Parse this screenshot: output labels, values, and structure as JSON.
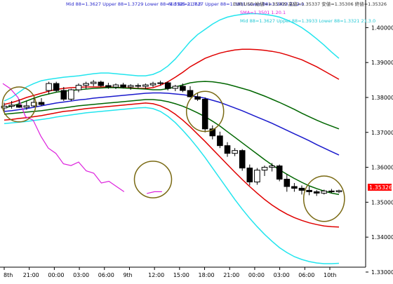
{
  "legend": {
    "line1_left": "Mid 88=1.3627 Upper 88=1.3729 Lower 88=1.3525  21.7.0",
    "line1_mid": "Mid 88=1.3627 Upper 88=1.3831 Lower 88=1.3423  21.2.0",
    "line1_right": "EUR/USD 始値=1.35309 高値=1.35337 安値=1.35306 終値=1.35326",
    "line2": "SMA=1.3501  1.20.1",
    "line3": "Mid 88=1.3627 Upper 88=1.3933 Lower 88=1.3321  21.3.0"
  },
  "current_price_label": "1.35326",
  "colors": {
    "background": "#ffffff",
    "mid_band": "#1a1acc",
    "band_1": "#006600",
    "band_2": "#e00000",
    "band_3": "#22e5ee",
    "sma": "#dd22dd",
    "circle": "#7a6a14",
    "candle": "#000000",
    "price_tag": "#ff0000"
  },
  "chart_data": {
    "type": "candlestick",
    "ylim": [
      1.332,
      1.4055
    ],
    "y_ticks": [
      "1.40000",
      "1.39000",
      "1.38000",
      "1.37000",
      "1.36000",
      "1.35000",
      "1.34000",
      "1.33000"
    ],
    "y_tick_values": [
      1.4,
      1.39,
      1.38,
      1.37,
      1.36,
      1.35,
      1.34,
      1.33
    ],
    "x_ticks": [
      "8th",
      "21:00",
      "00:00",
      "03:00",
      "06:00",
      "9th",
      "12:00",
      "15:00",
      "18:00",
      "21:00",
      "00:00",
      "03:00",
      "06:00",
      "10th"
    ],
    "candles": [
      {
        "o": 1.377,
        "h": 1.3785,
        "l": 1.3762,
        "c": 1.3775
      },
      {
        "o": 1.3775,
        "h": 1.379,
        "l": 1.3768,
        "c": 1.3778
      },
      {
        "o": 1.3778,
        "h": 1.3795,
        "l": 1.377,
        "c": 1.3772
      },
      {
        "o": 1.3772,
        "h": 1.379,
        "l": 1.3765,
        "c": 1.3776
      },
      {
        "o": 1.3776,
        "h": 1.38,
        "l": 1.3772,
        "c": 1.3786
      },
      {
        "o": 1.3786,
        "h": 1.3798,
        "l": 1.3776,
        "c": 1.378
      },
      {
        "o": 1.382,
        "h": 1.3845,
        "l": 1.381,
        "c": 1.384
      },
      {
        "o": 1.384,
        "h": 1.3845,
        "l": 1.3815,
        "c": 1.382
      },
      {
        "o": 1.382,
        "h": 1.383,
        "l": 1.379,
        "c": 1.3795
      },
      {
        "o": 1.3795,
        "h": 1.3825,
        "l": 1.379,
        "c": 1.3822
      },
      {
        "o": 1.3822,
        "h": 1.384,
        "l": 1.3815,
        "c": 1.3835
      },
      {
        "o": 1.3835,
        "h": 1.3845,
        "l": 1.3825,
        "c": 1.384
      },
      {
        "o": 1.384,
        "h": 1.385,
        "l": 1.3832,
        "c": 1.3844
      },
      {
        "o": 1.3844,
        "h": 1.3848,
        "l": 1.383,
        "c": 1.3834
      },
      {
        "o": 1.3834,
        "h": 1.3842,
        "l": 1.3825,
        "c": 1.383
      },
      {
        "o": 1.383,
        "h": 1.384,
        "l": 1.3824,
        "c": 1.3836
      },
      {
        "o": 1.3836,
        "h": 1.3842,
        "l": 1.3826,
        "c": 1.383
      },
      {
        "o": 1.383,
        "h": 1.3838,
        "l": 1.3822,
        "c": 1.3834
      },
      {
        "o": 1.3834,
        "h": 1.384,
        "l": 1.3826,
        "c": 1.3832
      },
      {
        "o": 1.3832,
        "h": 1.384,
        "l": 1.3825,
        "c": 1.3836
      },
      {
        "o": 1.3836,
        "h": 1.3845,
        "l": 1.383,
        "c": 1.384
      },
      {
        "o": 1.384,
        "h": 1.3848,
        "l": 1.3834,
        "c": 1.3842
      },
      {
        "o": 1.3842,
        "h": 1.3846,
        "l": 1.382,
        "c": 1.3826
      },
      {
        "o": 1.3826,
        "h": 1.3836,
        "l": 1.3818,
        "c": 1.3832
      },
      {
        "o": 1.3832,
        "h": 1.384,
        "l": 1.3815,
        "c": 1.382
      },
      {
        "o": 1.382,
        "h": 1.3832,
        "l": 1.38,
        "c": 1.3802
      },
      {
        "o": 1.3802,
        "h": 1.3812,
        "l": 1.379,
        "c": 1.3795
      },
      {
        "o": 1.3795,
        "h": 1.38,
        "l": 1.37,
        "c": 1.371
      },
      {
        "o": 1.371,
        "h": 1.372,
        "l": 1.368,
        "c": 1.369
      },
      {
        "o": 1.369,
        "h": 1.3702,
        "l": 1.3655,
        "c": 1.3662
      },
      {
        "o": 1.3662,
        "h": 1.3672,
        "l": 1.363,
        "c": 1.364
      },
      {
        "o": 1.364,
        "h": 1.3655,
        "l": 1.3632,
        "c": 1.3648
      },
      {
        "o": 1.3648,
        "h": 1.3652,
        "l": 1.359,
        "c": 1.3598
      },
      {
        "o": 1.3598,
        "h": 1.3608,
        "l": 1.3548,
        "c": 1.3558
      },
      {
        "o": 1.3558,
        "h": 1.3598,
        "l": 1.355,
        "c": 1.3592
      },
      {
        "o": 1.3592,
        "h": 1.3605,
        "l": 1.3575,
        "c": 1.36
      },
      {
        "o": 1.36,
        "h": 1.3612,
        "l": 1.3588,
        "c": 1.3604
      },
      {
        "o": 1.3604,
        "h": 1.3608,
        "l": 1.356,
        "c": 1.3566
      },
      {
        "o": 1.3566,
        "h": 1.358,
        "l": 1.353,
        "c": 1.3545
      },
      {
        "o": 1.3545,
        "h": 1.3555,
        "l": 1.353,
        "c": 1.354
      },
      {
        "o": 1.354,
        "h": 1.3548,
        "l": 1.3522,
        "c": 1.3534
      },
      {
        "o": 1.3534,
        "h": 1.3545,
        "l": 1.352,
        "c": 1.353
      },
      {
        "o": 1.353,
        "h": 1.3535,
        "l": 1.3518,
        "c": 1.3526
      },
      {
        "o": 1.3526,
        "h": 1.3536,
        "l": 1.3522,
        "c": 1.3532
      },
      {
        "o": 1.3532,
        "h": 1.3538,
        "l": 1.3526,
        "c": 1.353
      },
      {
        "o": 1.353,
        "h": 1.3536,
        "l": 1.3526,
        "c": 1.3533
      }
    ],
    "series": [
      {
        "key": "band_3_upper",
        "color_key": "band_3",
        "values": [
          1.379,
          1.38,
          1.3815,
          1.383,
          1.384,
          1.3848,
          1.3852,
          1.3855,
          1.3858,
          1.386,
          1.3862,
          1.3865,
          1.3868,
          1.387,
          1.387,
          1.3868,
          1.3866,
          1.3864,
          1.3862,
          1.3862,
          1.3866,
          1.3875,
          1.389,
          1.391,
          1.3935,
          1.396,
          1.398,
          1.3995,
          1.401,
          1.4022,
          1.403,
          1.4035,
          1.4038,
          1.404,
          1.404,
          1.4038,
          1.4035,
          1.403,
          1.4022,
          1.4012,
          1.4,
          1.3985,
          1.3968,
          1.395,
          1.393,
          1.3912
        ]
      },
      {
        "key": "band_2_upper",
        "color_key": "band_2",
        "values": [
          1.378,
          1.3785,
          1.3792,
          1.38,
          1.3806,
          1.3812,
          1.3818,
          1.3823,
          1.3826,
          1.3828,
          1.3829,
          1.383,
          1.383,
          1.383,
          1.383,
          1.3829,
          1.3828,
          1.3827,
          1.3826,
          1.3826,
          1.3828,
          1.3835,
          1.3845,
          1.3858,
          1.3872,
          1.3888,
          1.39,
          1.3912,
          1.392,
          1.3927,
          1.3932,
          1.3936,
          1.3938,
          1.3938,
          1.3937,
          1.3935,
          1.3932,
          1.3928,
          1.3922,
          1.3915,
          1.3908,
          1.3898,
          1.3888,
          1.3876,
          1.3864,
          1.3852
        ]
      },
      {
        "key": "band_1_upper",
        "color_key": "band_1",
        "values": [
          1.377,
          1.3775,
          1.3782,
          1.379,
          1.3798,
          1.3805,
          1.381,
          1.3815,
          1.3818,
          1.382,
          1.3822,
          1.3824,
          1.3826,
          1.3827,
          1.3828,
          1.3828,
          1.3827,
          1.3826,
          1.3825,
          1.3824,
          1.3822,
          1.3822,
          1.3825,
          1.383,
          1.3836,
          1.3842,
          1.3845,
          1.3846,
          1.3845,
          1.3842,
          1.3838,
          1.3832,
          1.3826,
          1.382,
          1.3812,
          1.3804,
          1.3795,
          1.3786,
          1.3776,
          1.3766,
          1.3755,
          1.3745,
          1.3735,
          1.3726,
          1.3718,
          1.371
        ]
      },
      {
        "key": "mid",
        "color_key": "mid_band",
        "values": [
          1.376,
          1.3762,
          1.3765,
          1.3768,
          1.3772,
          1.3776,
          1.378,
          1.3784,
          1.3787,
          1.379,
          1.3793,
          1.3795,
          1.3798,
          1.38,
          1.3802,
          1.3804,
          1.3806,
          1.3808,
          1.381,
          1.3812,
          1.3813,
          1.3813,
          1.3812,
          1.381,
          1.3808,
          1.3805,
          1.3802,
          1.3798,
          1.3792,
          1.3786,
          1.3778,
          1.377,
          1.3762,
          1.3753,
          1.3744,
          1.3735,
          1.3726,
          1.3716,
          1.3706,
          1.3696,
          1.3686,
          1.3676,
          1.3665,
          1.3655,
          1.3645,
          1.3635
        ]
      },
      {
        "key": "band_1_lower",
        "color_key": "band_1",
        "values": [
          1.3752,
          1.3754,
          1.3756,
          1.3758,
          1.376,
          1.3762,
          1.3765,
          1.3768,
          1.377,
          1.3773,
          1.3776,
          1.3778,
          1.378,
          1.3782,
          1.3784,
          1.3786,
          1.3788,
          1.379,
          1.3792,
          1.3794,
          1.3794,
          1.3792,
          1.3788,
          1.3782,
          1.3775,
          1.3766,
          1.3756,
          1.3745,
          1.3732,
          1.3718,
          1.3702,
          1.3686,
          1.367,
          1.3654,
          1.3638,
          1.3622,
          1.3607,
          1.3593,
          1.358,
          1.3568,
          1.3557,
          1.3547,
          1.3539,
          1.3532,
          1.3526,
          1.3522
        ]
      },
      {
        "key": "band_2_lower",
        "color_key": "band_2",
        "values": [
          1.3735,
          1.3737,
          1.374,
          1.3742,
          1.3745,
          1.3748,
          1.3752,
          1.3756,
          1.376,
          1.3762,
          1.3765,
          1.3768,
          1.377,
          1.3772,
          1.3774,
          1.3776,
          1.3778,
          1.378,
          1.3782,
          1.3784,
          1.3782,
          1.3776,
          1.3766,
          1.3752,
          1.3735,
          1.3716,
          1.3695,
          1.3674,
          1.3652,
          1.363,
          1.3608,
          1.3586,
          1.3565,
          1.3545,
          1.3526,
          1.3508,
          1.3492,
          1.3478,
          1.3466,
          1.3456,
          1.3448,
          1.3441,
          1.3436,
          1.3432,
          1.343,
          1.3429
        ]
      },
      {
        "key": "band_3_lower",
        "color_key": "band_3",
        "values": [
          1.3725,
          1.3727,
          1.3729,
          1.3731,
          1.3734,
          1.3737,
          1.374,
          1.3744,
          1.3747,
          1.375,
          1.3753,
          1.3756,
          1.3758,
          1.376,
          1.3762,
          1.3764,
          1.3766,
          1.3768,
          1.377,
          1.3771,
          1.3768,
          1.376,
          1.3746,
          1.3728,
          1.3706,
          1.3682,
          1.3656,
          1.3628,
          1.3598,
          1.3568,
          1.3538,
          1.3508,
          1.348,
          1.3454,
          1.343,
          1.3408,
          1.3388,
          1.337,
          1.3356,
          1.3344,
          1.3336,
          1.333,
          1.3326,
          1.3324,
          1.3324,
          1.3325
        ]
      },
      {
        "key": "sma",
        "color_key": "sma",
        "start_index": 0,
        "values": [
          1.384,
          1.3825,
          1.38,
          1.3745,
          1.3735,
          1.369,
          1.3655,
          1.364,
          1.361,
          1.3605,
          1.3615,
          1.359,
          1.3583,
          1.3555,
          1.356,
          1.3545,
          1.353,
          null,
          null,
          1.3525,
          1.353,
          1.353
        ]
      }
    ],
    "highlight_circles": [
      {
        "center_index": 2,
        "center_value": 1.378,
        "span_bars": 4.5,
        "span_price": 0.01
      },
      {
        "center_index": 20,
        "center_value": 1.3565,
        "span_bars": 5.0,
        "span_price": 0.0105
      },
      {
        "center_index": 27,
        "center_value": 1.376,
        "span_bars": 5.0,
        "span_price": 0.0115
      },
      {
        "center_index": 43,
        "center_value": 1.351,
        "span_bars": 5.5,
        "span_price": 0.013
      }
    ]
  }
}
